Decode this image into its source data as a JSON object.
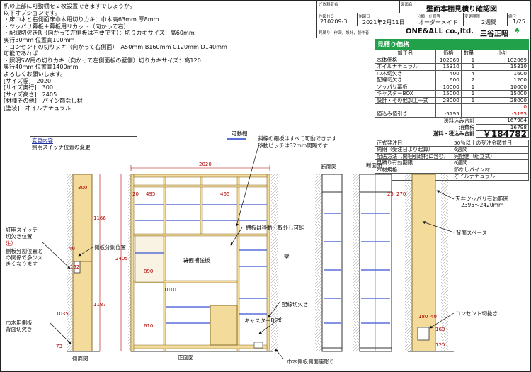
{
  "notes": {
    "lines": [
      "机の上部に可動棚を２枚設置できますでしょうか。",
      "以下オプションです。",
      "・床巾木と右側面床巾木用切りカキ：巾木高63mm 厚8mm",
      "・ツッパリ幕板＋幕板用リカット（向かって右）",
      "・配線切欠きR（向かって左側板は不要です）：切りカキサイズ：高60mm",
      "奥行30mm 位置高100mm",
      "・コンセントの切りヌキ（向かって右側面）　A50mm B160mm C120mm D140mm",
      "可能であれば",
      "・照明SW用の切りカキ（向かって左側面板の壁側）切りカキサイズ：高120",
      "奥行40mm 位置高1400mm",
      "よろしくお願いします。",
      "[サイズ幅]　2020",
      "[サイズ奥行]　300",
      "[サイズ高さ]　2405",
      "[材種その他]　パイン節なし材",
      "[塗装]　オイルナチュラル"
    ]
  },
  "header": {
    "client_label": "ご依頼者名",
    "drawing_label": "図面名",
    "drawing_title": "壁面本棚見積り確認図",
    "number_label": "作図ＮＯ",
    "number": "210209-3",
    "date_label": "作図日",
    "date": "2021年2月11日",
    "category_label": "分類，仕様等",
    "category": "オーダーメイド",
    "period_label": "変更期限",
    "period": "2週間",
    "scale_label": "縮尺",
    "scale": "1/25",
    "maker_label": "見積り，作図，設計，製作者",
    "maker": "ONE&ALL co.,ltd.",
    "designer": "三谷正昭"
  },
  "estimate": {
    "title": "見積り価格",
    "col_item": "加工名",
    "col_price": "価格",
    "col_qty": "数量",
    "col_subtotal": "小計",
    "rows": [
      {
        "name": "本体価格",
        "price": "102069",
        "qty": "1",
        "subtotal": "102069"
      },
      {
        "name": "オイルナチュラル",
        "price": "15310",
        "qty": "1",
        "subtotal": "15310"
      },
      {
        "name": "巾木切欠き",
        "price": "400",
        "qty": "4",
        "subtotal": "1600"
      },
      {
        "name": "配線切欠き",
        "price": "600",
        "qty": "2",
        "subtotal": "1200"
      },
      {
        "name": "ツッパリ幕板",
        "price": "10000",
        "qty": "1",
        "subtotal": "10000"
      },
      {
        "name": "キャスターBOX",
        "price": "15000",
        "qty": "1",
        "subtotal": "15000"
      },
      {
        "name": "設計・その他加工一式",
        "price": "28000",
        "qty": "1",
        "subtotal": "28000"
      }
    ],
    "extra": "0",
    "discount_label": "値込み値引き",
    "discount": "-5195",
    "discount_sub": "-5195",
    "subtotal_label": "送料込み合計",
    "subtotal": "167984",
    "tax_label": "消費税",
    "tax": "16798",
    "total_label": "送料・税込み合計",
    "total": "￥184782",
    "info": [
      {
        "k": "正式発注日",
        "v": "50％以上の受注金額並日"
      },
      {
        "k": "納期（受注日より起算）",
        "v": "6週間"
      },
      {
        "k": "配送方法（開梱引越相に含む）",
        "v": "完配便（組立式）"
      },
      {
        "k": "見積り有効期限",
        "v": "6週間"
      },
      {
        "k": "本材規格",
        "v": "節なしパイン材"
      },
      {
        "k": "塗装",
        "v": "オイルナチュラル"
      }
    ]
  },
  "change": {
    "title": "変更内容",
    "item": "照明スイッチ位置の変更"
  },
  "legend": {
    "movable": "可動棚",
    "note1": "斜線の棚板はすべて可動できます",
    "note2": "移動ピッチは32mm間隔です"
  },
  "labels": {
    "shelf_move": "棚板は移動・取外し可能",
    "back_board": "背面補強板",
    "wiring_cut": "配線切欠き",
    "caster_box": "キャスターBOX",
    "wall": "壁",
    "side_partition": "側板分割位置",
    "switch_cut1": "証明スイッチ",
    "switch_cut2": "切欠き位置",
    "note_title": "注）",
    "note_text1": "側板分割位置と",
    "note_text2": "の関係で多少大",
    "note_text3": "きくなります",
    "baseboard_cut1": "巾木用側板",
    "baseboard_cut2": "背面切欠き",
    "side_view": "側面図",
    "front_view": "正面図",
    "section1": "断面図",
    "section2": "断面図",
    "ceiling1": "天井ツッパリ有効範囲",
    "ceiling2": "2395～2420mm",
    "back_space": "背面スペース",
    "outlet": "コンセント切抜き",
    "baseboard_side": "巾木側板側面座彫り"
  },
  "dims": {
    "width": "2020",
    "d300": "300",
    "d40": "40",
    "d152": "152",
    "d1166": "1166",
    "d2405": "2405",
    "d1187": "1187",
    "d1035": "1035",
    "d73": "73",
    "d20": "20",
    "d495": "495",
    "d465": "465",
    "d890": "890",
    "d1010": "1010",
    "d610": "610",
    "d270": "270",
    "d25": "25",
    "d180": "180",
    "d40b": "40",
    "d160": "160",
    "d120": "120"
  },
  "colors": {
    "wood": "#f3dc9b",
    "wood_edge": "#8a6d2d",
    "shelf": "#5a6fd8",
    "dim": "#b00000",
    "green": "#21a24a"
  }
}
